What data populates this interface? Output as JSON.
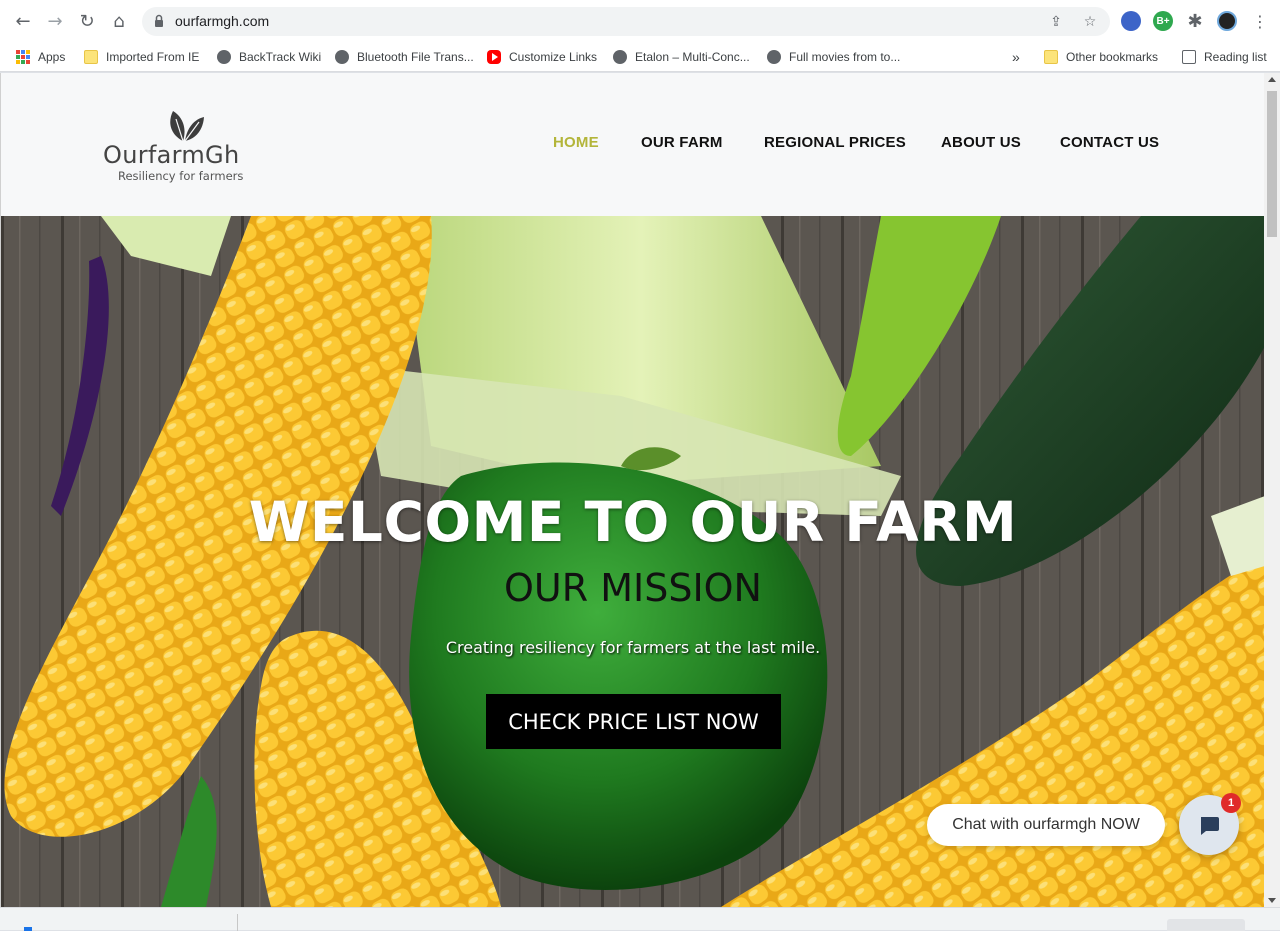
{
  "browser": {
    "url": "ourfarmgh.com",
    "bookmarks": [
      {
        "label": "Apps",
        "icon": "apps-icon"
      },
      {
        "label": "Imported From IE",
        "icon": "folder-icon"
      },
      {
        "label": "BackTrack Wiki",
        "icon": "globe-icon"
      },
      {
        "label": "Bluetooth File Trans...",
        "icon": "globe-icon"
      },
      {
        "label": "Customize Links",
        "icon": "youtube-icon"
      },
      {
        "label": "Etalon – Multi-Conc...",
        "icon": "globe-icon"
      },
      {
        "label": "Full movies from to...",
        "icon": "globe-icon"
      }
    ],
    "overflow": "»",
    "other_bookmarks": "Other bookmarks",
    "reading_list": "Reading list",
    "extension_badge": "B+"
  },
  "site": {
    "logo_name": "OurfarmGh",
    "logo_tagline": "Resiliency for farmers",
    "nav": [
      {
        "label": "HOME",
        "active": true
      },
      {
        "label": "OUR FARM",
        "active": false
      },
      {
        "label": "REGIONAL PRICES",
        "active": false
      },
      {
        "label": "ABOUT US",
        "active": false
      },
      {
        "label": "CONTACT US",
        "active": false
      }
    ],
    "accent_color": "#b3b53a"
  },
  "hero": {
    "title": "WELCOME TO OUR FARM",
    "subtitle": "OUR MISSION",
    "line": "Creating resiliency for farmers at the last mile.",
    "cta": "CHECK PRICE LIST NOW"
  },
  "chat": {
    "prompt": "Chat with ourfarmgh NOW",
    "badge": "1"
  }
}
